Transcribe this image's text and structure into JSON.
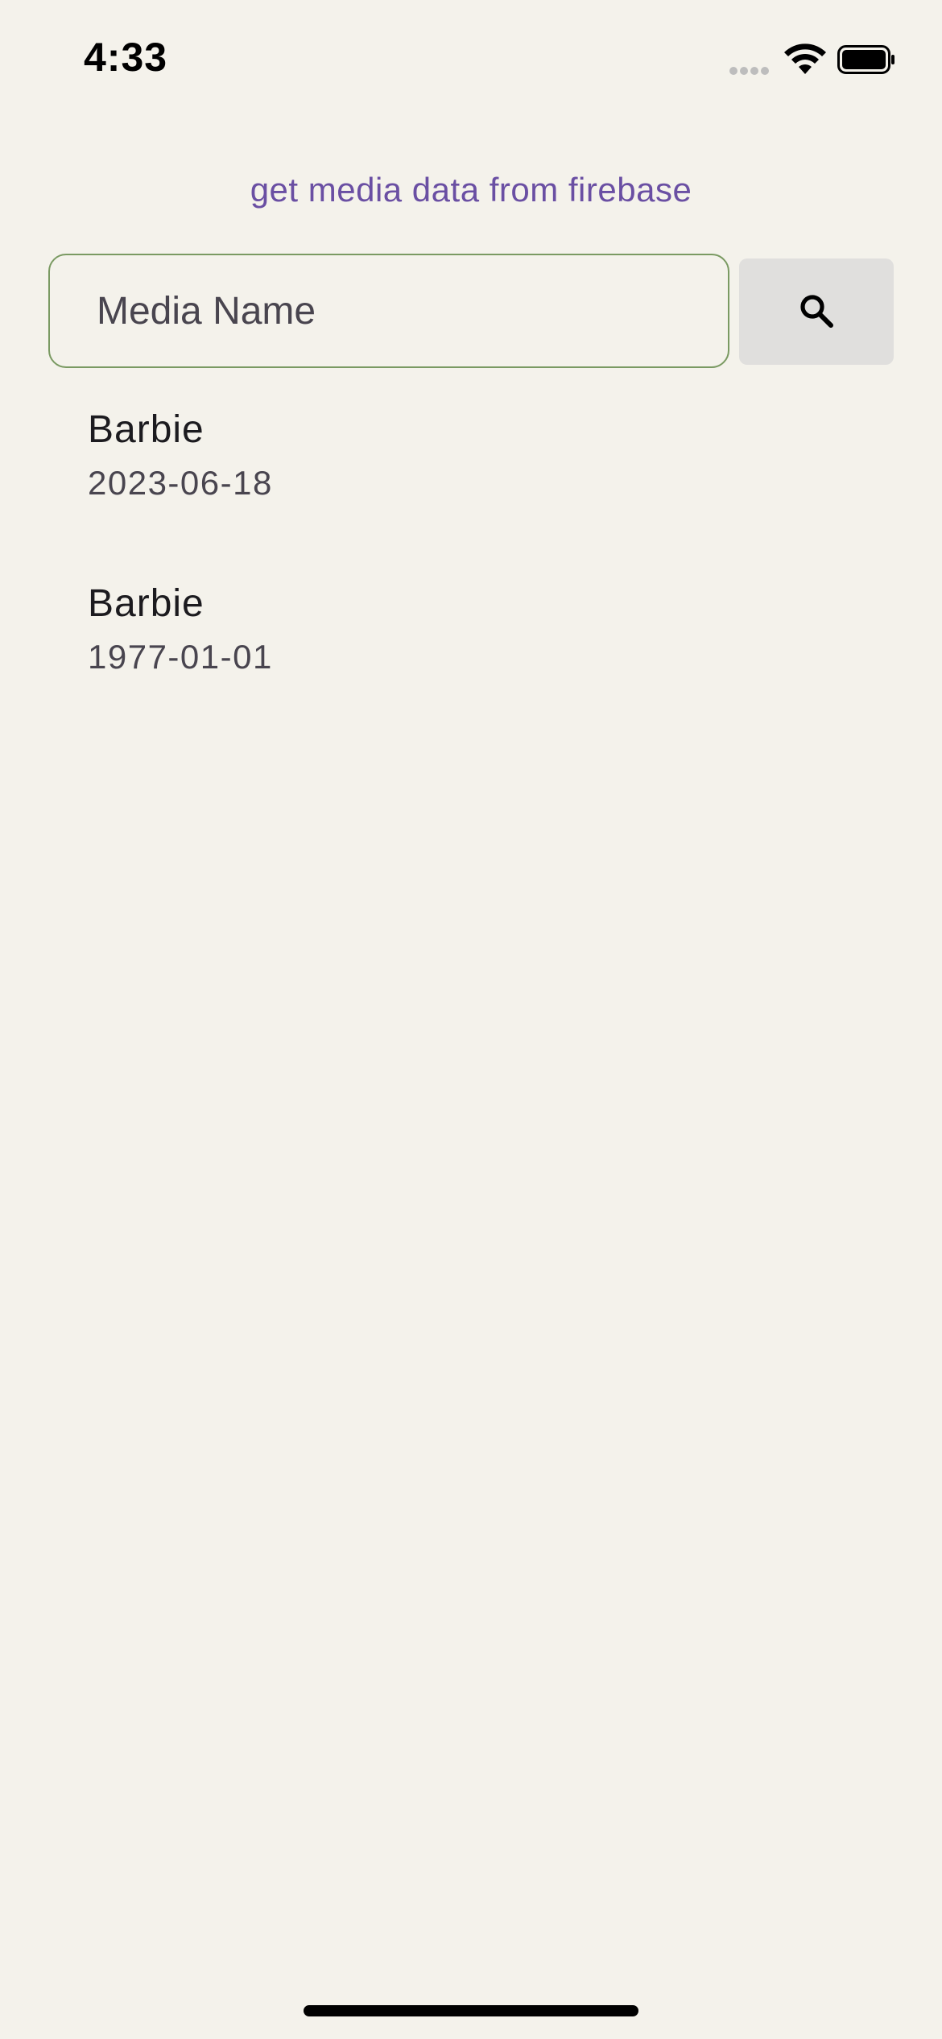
{
  "status_bar": {
    "time": "4:33",
    "icons": [
      "signal-dots-icon",
      "wifi-icon",
      "battery-icon"
    ]
  },
  "header": {
    "title": "get media data from firebase"
  },
  "search": {
    "placeholder": "Media Name",
    "value": "",
    "button_icon": "search-icon"
  },
  "results": [
    {
      "title": "Barbie",
      "date": "2023-06-18"
    },
    {
      "title": "Barbie",
      "date": "1977-01-01"
    }
  ],
  "colors": {
    "background": "#f4f2eb",
    "accent": "#6a4fa3",
    "input_border": "#7a9a62",
    "button_bg": "#e0dfdd"
  }
}
